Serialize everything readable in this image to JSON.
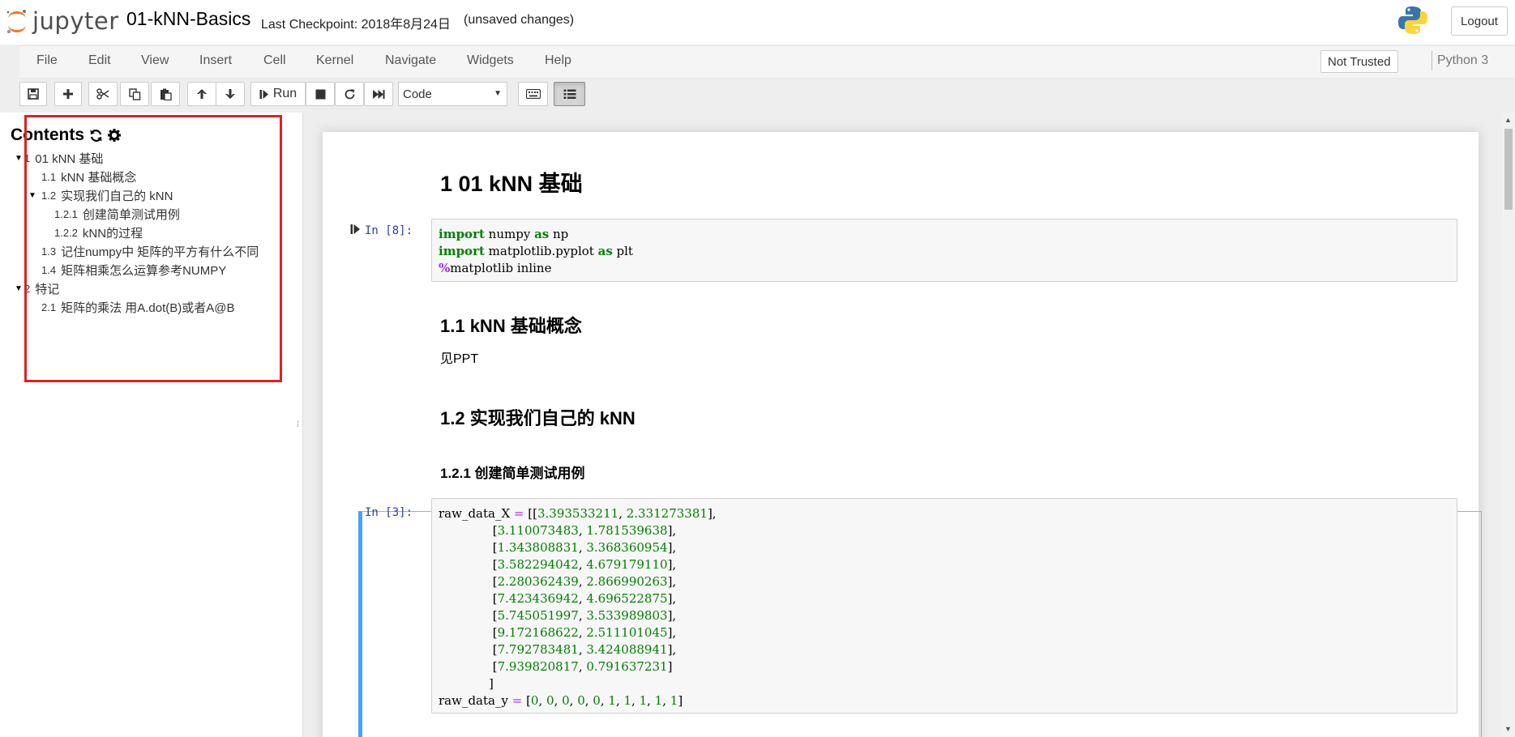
{
  "header": {
    "logo_text": "jupyter",
    "notebook_title": "01-kNN-Basics",
    "checkpoint": "Last Checkpoint: 2018年8月24日",
    "autosave_status": "(unsaved changes)",
    "logout_label": "Logout"
  },
  "menubar": {
    "items": [
      "File",
      "Edit",
      "View",
      "Insert",
      "Cell",
      "Kernel",
      "Navigate",
      "Widgets",
      "Help"
    ],
    "trust_label": "Not Trusted",
    "kernel_name": "Python 3"
  },
  "toolbar": {
    "run_label": "Run",
    "cell_type": "Code",
    "icons": [
      "save-icon",
      "plus-icon",
      "cut-icon",
      "copy-icon",
      "paste-icon",
      "arrow-up-icon",
      "arrow-down-icon",
      "step-forward-icon",
      "stop-icon",
      "refresh-icon",
      "fast-forward-icon",
      "keyboard-icon",
      "list-icon"
    ]
  },
  "toc": {
    "title": "Contents",
    "items": [
      {
        "num": "1",
        "label": "01 kNN 基础"
      },
      {
        "num": "1.1",
        "label": "kNN 基础概念"
      },
      {
        "num": "1.2",
        "label": "实现我们自己的 kNN"
      },
      {
        "num": "1.2.1",
        "label": "创建简单测试用例"
      },
      {
        "num": "1.2.2",
        "label": "kNN的过程"
      },
      {
        "num": "1.3",
        "label": "记住numpy中 矩阵的平方有什么不同"
      },
      {
        "num": "1.4",
        "label": "矩阵相乘怎么运算参考NUMPY"
      },
      {
        "num": "2",
        "label": "特记"
      },
      {
        "num": "2.1",
        "label": "矩阵的乘法 用A.dot(B)或者A@B"
      }
    ]
  },
  "notebook": {
    "h1": "1  01 kNN 基础",
    "cell1_prompt": "In  [8]:",
    "h2_1": "1.1  kNN 基础概念",
    "p1": "见PPT",
    "h2_2": "1.2  实现我们自己的 kNN",
    "h3_1": "1.2.1  创建简单测试用例",
    "cell2_prompt": "In  [3]:"
  }
}
